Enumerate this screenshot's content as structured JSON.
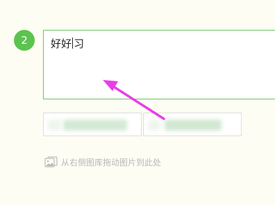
{
  "step": {
    "number": "2"
  },
  "editor": {
    "text_before_caret": "好好",
    "text_after_caret": "习"
  },
  "buttons": {
    "left_label": "",
    "right_label": ""
  },
  "upload_hint": {
    "icon": "image-icon",
    "text": "从右侧图库拖动图片到此处"
  },
  "annotation": {
    "icon": "pointer-arrow-icon",
    "color": "#e83ee8"
  },
  "colors": {
    "accent_green": "#5cc34f",
    "border_green": "#6cc260",
    "background": "#fdfdf3",
    "hint_gray": "#b8b8b8"
  }
}
